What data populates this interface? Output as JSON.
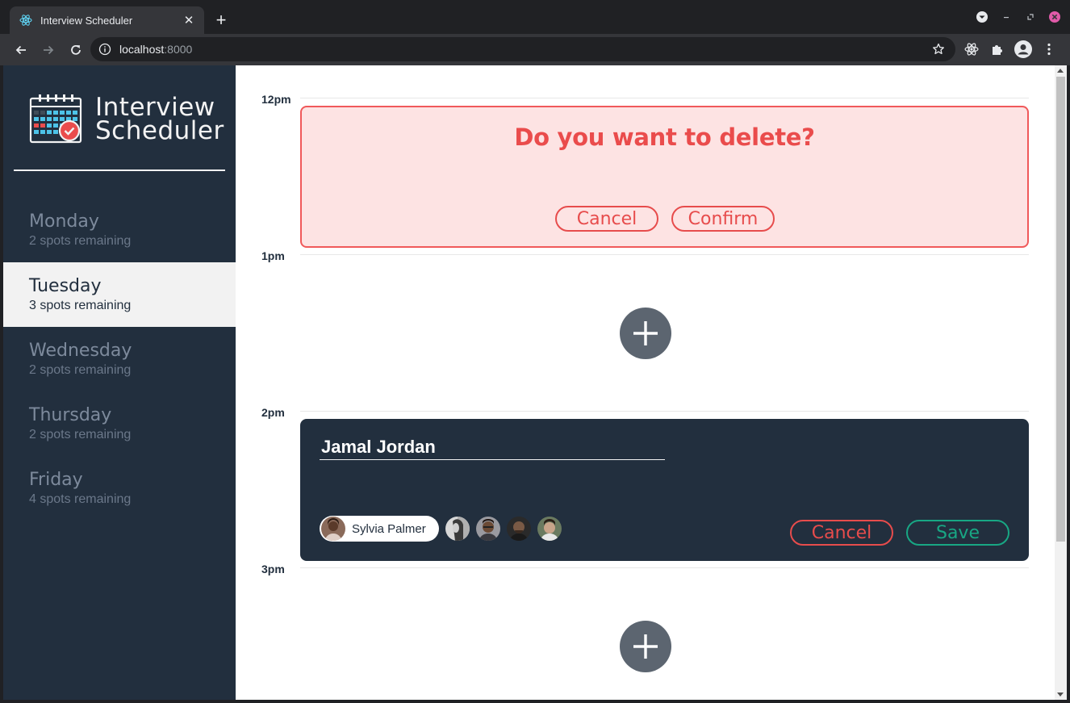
{
  "browser": {
    "tab_title": "Interview Scheduler",
    "new_tab_symbol": "+",
    "tab_close_symbol": "✕",
    "url_host": "localhost",
    "url_port": ":8000"
  },
  "brand": {
    "line1": "Interview",
    "line2": "Scheduler"
  },
  "days": [
    {
      "name": "Monday",
      "spots": "2 spots remaining",
      "selected": false
    },
    {
      "name": "Tuesday",
      "spots": "3 spots remaining",
      "selected": true
    },
    {
      "name": "Wednesday",
      "spots": "2 spots remaining",
      "selected": false
    },
    {
      "name": "Thursday",
      "spots": "2 spots remaining",
      "selected": false
    },
    {
      "name": "Friday",
      "spots": "4 spots remaining",
      "selected": false
    }
  ],
  "slots": {
    "t12": "12pm",
    "t1": "1pm",
    "t2": "2pm",
    "t3": "3pm"
  },
  "confirm": {
    "message": "Do you want to delete?",
    "cancel_label": "Cancel",
    "confirm_label": "Confirm"
  },
  "form": {
    "student_name": "Jamal Jordan",
    "selected_interviewer": "Sylvia Palmer",
    "cancel_label": "Cancel",
    "save_label": "Save"
  },
  "colors": {
    "sidebar": "#222f3e",
    "danger": "#e74c4c",
    "save": "#18a784",
    "confirm_bg": "#fde3e3",
    "add_button": "#5c6570"
  }
}
